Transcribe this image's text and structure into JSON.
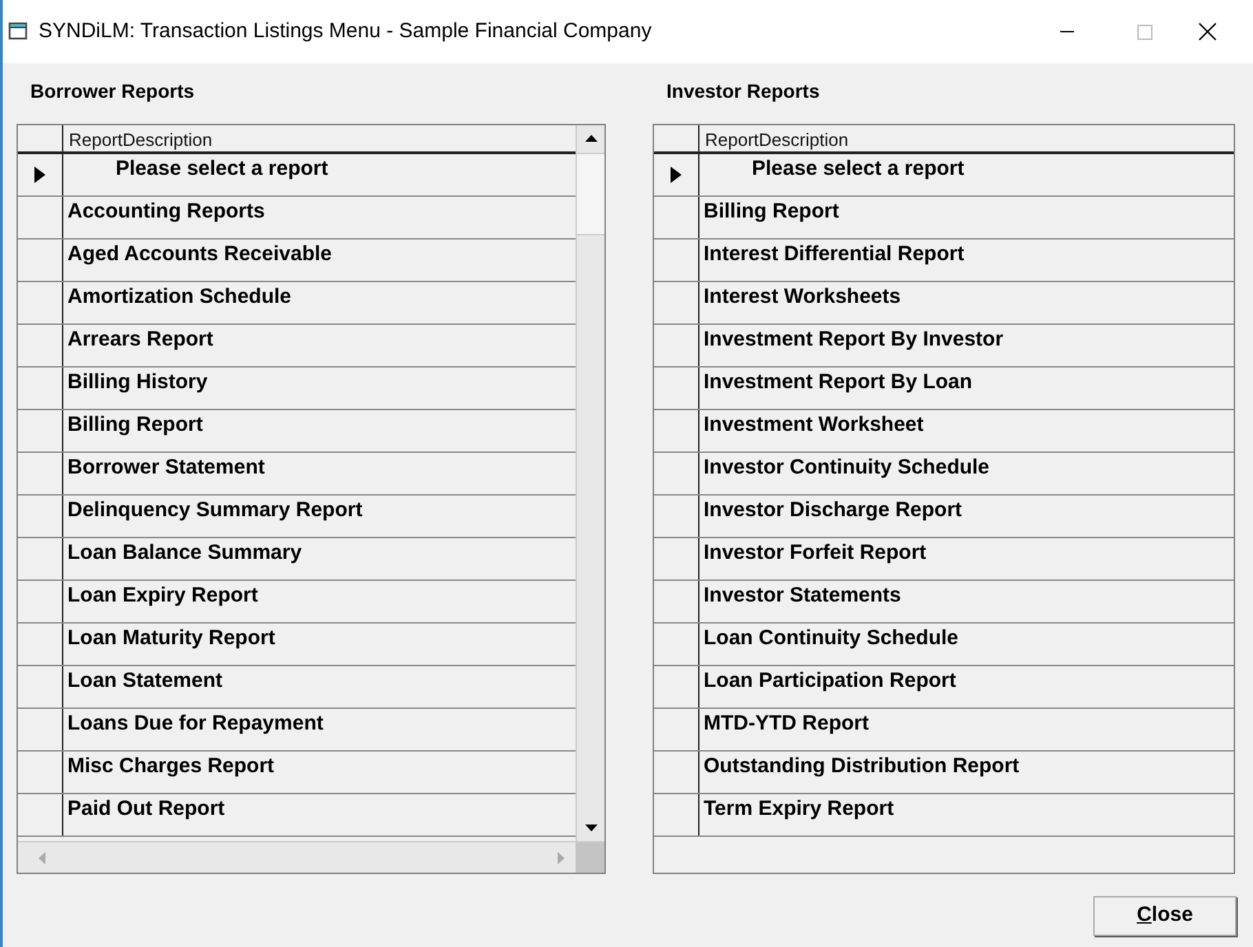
{
  "window": {
    "title": "SYNDiLM: Transaction Listings Menu - Sample Financial Company"
  },
  "panels": [
    {
      "title": "Borrower Reports",
      "column": "ReportDescription",
      "scrollbars": true,
      "rows": [
        {
          "text": "Please select a report",
          "selected": true
        },
        {
          "text": "Accounting Reports",
          "selected": false
        },
        {
          "text": "Aged Accounts Receivable",
          "selected": false
        },
        {
          "text": "Amortization Schedule",
          "selected": false
        },
        {
          "text": "Arrears Report",
          "selected": false
        },
        {
          "text": "Billing History",
          "selected": false
        },
        {
          "text": "Billing Report",
          "selected": false
        },
        {
          "text": "Borrower Statement",
          "selected": false
        },
        {
          "text": "Delinquency Summary Report",
          "selected": false
        },
        {
          "text": "Loan Balance Summary",
          "selected": false
        },
        {
          "text": "Loan Expiry Report",
          "selected": false
        },
        {
          "text": "Loan Maturity Report",
          "selected": false
        },
        {
          "text": "Loan Statement",
          "selected": false
        },
        {
          "text": "Loans Due for Repayment",
          "selected": false
        },
        {
          "text": "Misc Charges Report",
          "selected": false
        },
        {
          "text": "Paid Out Report",
          "selected": false
        }
      ]
    },
    {
      "title": "Investor Reports",
      "column": "ReportDescription",
      "scrollbars": false,
      "rows": [
        {
          "text": "Please select a report",
          "selected": true
        },
        {
          "text": "Billing Report",
          "selected": false
        },
        {
          "text": "Interest Differential Report",
          "selected": false
        },
        {
          "text": "Interest Worksheets",
          "selected": false
        },
        {
          "text": "Investment Report By Investor",
          "selected": false
        },
        {
          "text": "Investment Report By Loan",
          "selected": false
        },
        {
          "text": "Investment Worksheet",
          "selected": false
        },
        {
          "text": "Investor Continuity Schedule",
          "selected": false
        },
        {
          "text": "Investor Discharge Report",
          "selected": false
        },
        {
          "text": "Investor Forfeit Report",
          "selected": false
        },
        {
          "text": "Investor Statements",
          "selected": false
        },
        {
          "text": "Loan Continuity Schedule",
          "selected": false
        },
        {
          "text": "Loan Participation Report",
          "selected": false
        },
        {
          "text": "MTD-YTD Report",
          "selected": false
        },
        {
          "text": "Outstanding Distribution Report",
          "selected": false
        },
        {
          "text": "Term Expiry Report",
          "selected": false
        }
      ]
    }
  ],
  "close_button": {
    "label": "Close"
  }
}
